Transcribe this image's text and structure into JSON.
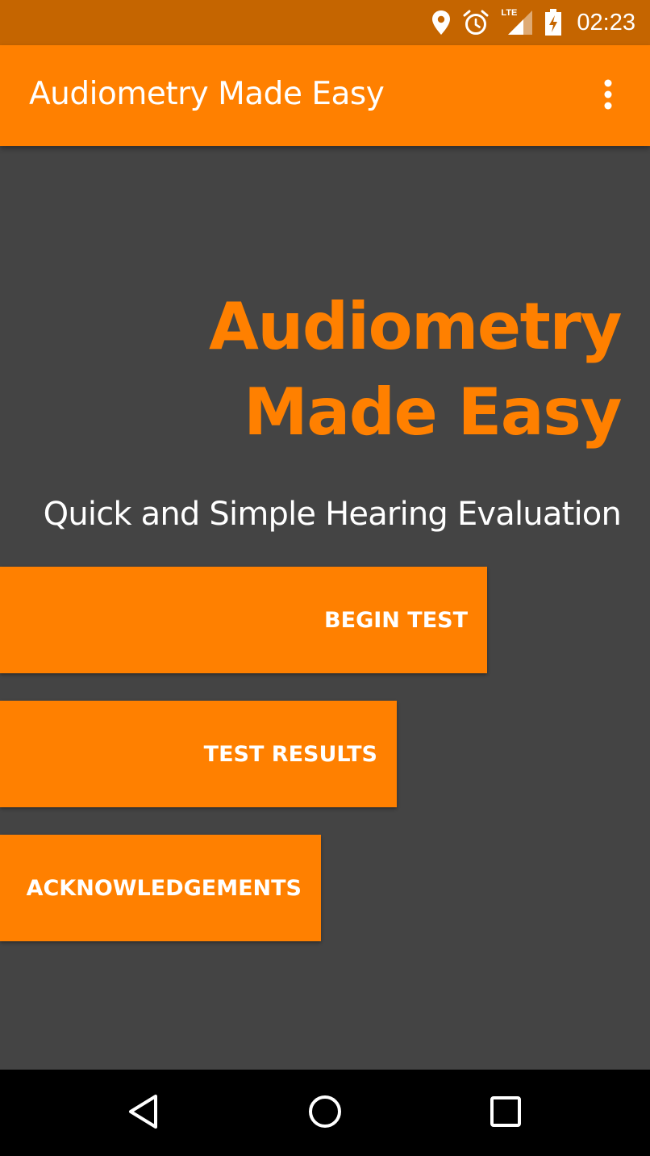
{
  "status_bar": {
    "time": "02:23",
    "network_label": "LTE",
    "icons": [
      "location-icon",
      "alarm-icon",
      "lte-signal-icon",
      "battery-charging-icon"
    ]
  },
  "app_bar": {
    "title": "Audiometry Made Easy",
    "menu_icon": "overflow-menu-icon"
  },
  "main": {
    "hero_title": "Audiometry Made Easy",
    "subtitle": "Quick and Simple Hearing Evaluation",
    "buttons": [
      {
        "label": "BEGIN TEST"
      },
      {
        "label": "TEST RESULTS"
      },
      {
        "label": "ACKNOWLEDGEMENTS"
      }
    ]
  },
  "nav_bar": {
    "icons": [
      "back-icon",
      "home-icon",
      "recents-icon"
    ]
  },
  "colors": {
    "accent": "#FF8000",
    "status_bar": "#C56500",
    "background": "#444444",
    "nav_bar": "#000000",
    "text_on_accent": "#FFFFFF"
  }
}
